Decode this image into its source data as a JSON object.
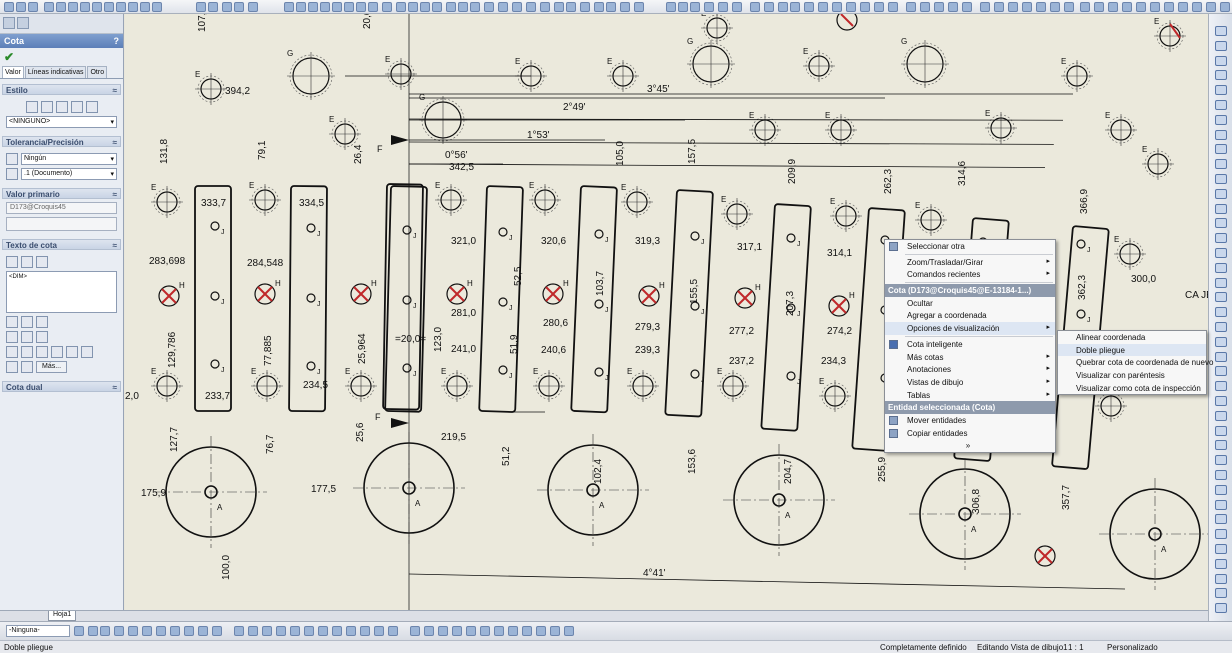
{
  "property_manager": {
    "title": "Cota",
    "help": "?",
    "tabs": [
      "Valor",
      "Líneas indicativas",
      "Otro"
    ],
    "groups": {
      "estilo": "Estilo",
      "estilo_select": "<NINGUNO>",
      "tolerancia": "Tolerancia/Precisión",
      "tolerancia_select": "Ningún",
      "precision_select": ".1 (Documento)",
      "valor_primario": "Valor primario",
      "valor_field": "D173@Croquis45",
      "texto_cota": "Texto de cota",
      "texto_content": "<DIM>",
      "mas_button": "Más...",
      "cota_dual": "Cota dual"
    }
  },
  "drawing": {
    "dims_top": [
      "107,5",
      "394,2",
      "20,0",
      "3°45'",
      "2°49'",
      "1°53'",
      "0°56'",
      "342,5",
      "131,8",
      "79,1",
      "26,4",
      "105,0",
      "157,5",
      "209,9",
      "262,3",
      "314,6",
      "366,9"
    ],
    "dims_mid": [
      "333,7",
      "334,5",
      "321,0",
      "320,6",
      "319,3",
      "317,1",
      "314,1",
      "300,0",
      "283,698",
      "284,548",
      "281,0",
      "280,6",
      "279,3",
      "277,2",
      "274,2",
      "129,786",
      "77,885",
      "25,964",
      "52,5",
      "103,7",
      "155,5",
      "207,3",
      "362,3",
      "123,0",
      "51,9",
      "=20,0=",
      "241,0",
      "240,6",
      "239,3",
      "237,2",
      "234,3",
      "233,7",
      "234,5",
      "2,0",
      "219,5",
      "25,6"
    ],
    "dims_bottom": [
      "127,7",
      "76,7",
      "175,9",
      "177,5",
      "51,2",
      "102,4",
      "153,6",
      "204,7",
      "255,9",
      "306,8",
      "357,7",
      "100,0",
      "4°41'"
    ],
    "labels": [
      "E",
      "G",
      "H",
      "J",
      "A",
      "F",
      "CA JE"
    ]
  },
  "context_menu": {
    "items": [
      {
        "label": "Seleccionar otra",
        "type": "item"
      },
      {
        "label": "Zoom/Trasladar/Girar",
        "type": "item",
        "sub": true
      },
      {
        "label": "Comandos recientes",
        "type": "item",
        "sub": true
      },
      {
        "label": "Cota (D173@Croquis45@E-13184-1...)",
        "type": "head"
      },
      {
        "label": "Ocultar",
        "type": "item"
      },
      {
        "label": "Agregar a coordenada",
        "type": "item"
      },
      {
        "label": "Opciones de visualización",
        "type": "item",
        "sub": true,
        "hl": true
      },
      {
        "label": "Cota inteligente",
        "type": "item"
      },
      {
        "label": "Más cotas",
        "type": "item",
        "sub": true
      },
      {
        "label": "Anotaciones",
        "type": "item",
        "sub": true
      },
      {
        "label": "Vistas de dibujo",
        "type": "item",
        "sub": true
      },
      {
        "label": "Tablas",
        "type": "item",
        "sub": true
      },
      {
        "label": "Entidad seleccionada (Cota)",
        "type": "head"
      },
      {
        "label": "Mover entidades",
        "type": "item"
      },
      {
        "label": "Copiar entidades",
        "type": "item"
      },
      {
        "label": "»",
        "type": "more"
      }
    ],
    "submenu": [
      "Alinear coordenada",
      "Doble pliegue",
      "Quebrar cota de coordenada de nuevo",
      "Visualizar con paréntesis",
      "Visualizar como cota de inspección"
    ]
  },
  "sheet_tab": "Hoja1",
  "bottom_select": "-Ninguna-",
  "status": {
    "left": "Doble pliegue",
    "definition": "Completamente definido",
    "mode": "Editando Vista de dibujo1",
    "scale": "1 : 1",
    "custom": "Personalizado"
  }
}
